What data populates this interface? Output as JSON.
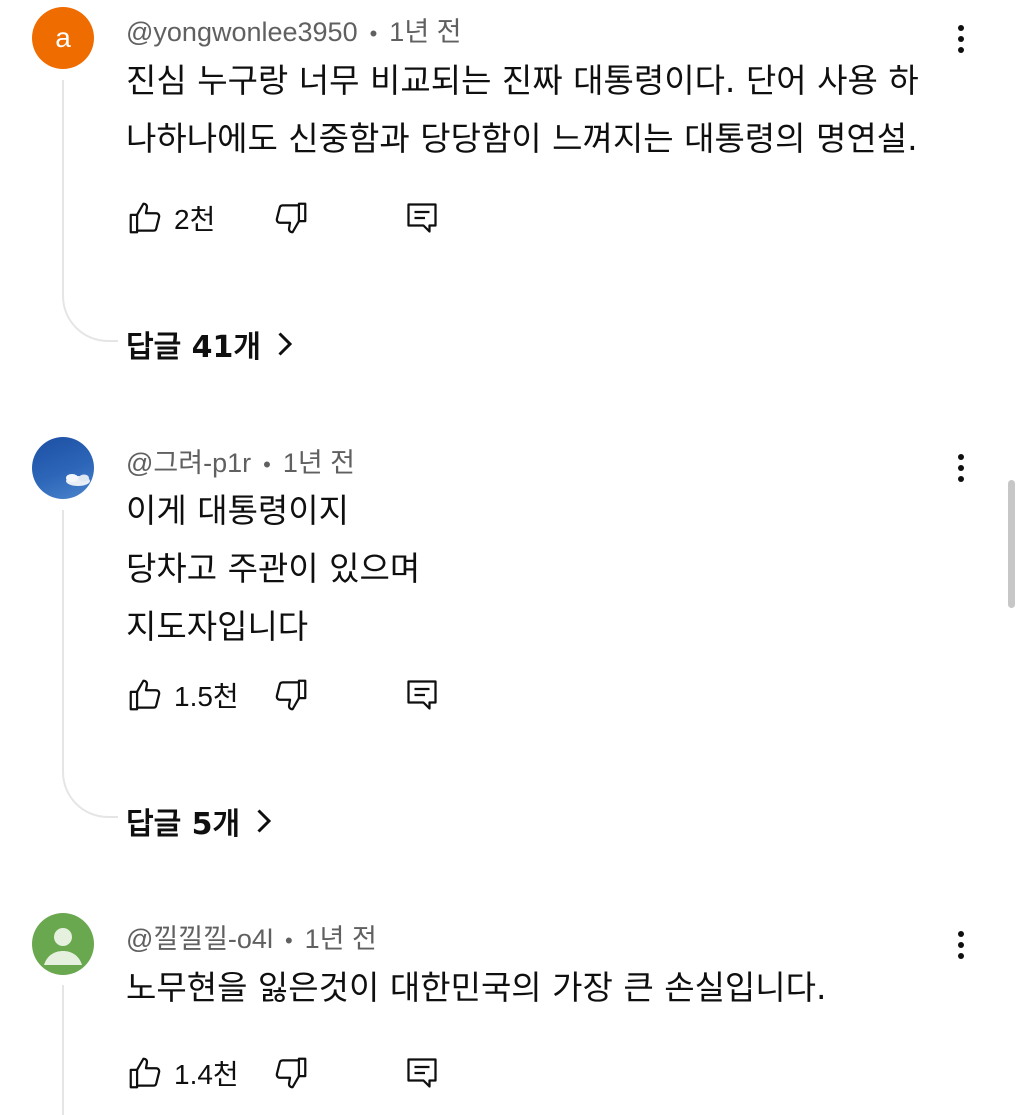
{
  "comments": [
    {
      "handle": "@yongwonlee3950",
      "time": "1년 전",
      "avatar_letter": "a",
      "avatar_color": "#ef6c00",
      "lines": [
        "진심 누구랑 너무 비교되는 진짜 대통령이다. 단어 사용 하",
        "나하나에도 신중함과 당당함이 느껴지는 대통령의 명연설."
      ],
      "likes": "2천",
      "replies": "답글 41개"
    },
    {
      "handle": "@그려-p1r",
      "time": "1년 전",
      "avatar_type": "sky-photo",
      "lines": [
        "이게 대통령이지",
        "당차고 주관이 있으며",
        "지도자입니다"
      ],
      "likes": "1.5천",
      "replies": "답글 5개"
    },
    {
      "handle": "@낄낄낄-o4l",
      "time": "1년 전",
      "avatar_type": "default-person",
      "avatar_color": "#6aa84f",
      "lines": [
        "노무현을 잃은것이 대한민국의 가장 큰 손실입니다."
      ],
      "likes": "1.4천"
    }
  ],
  "icons": {
    "like": "thumb-up-icon",
    "dislike": "thumb-down-icon",
    "reply": "reply-comment-icon",
    "more": "more-vert-icon",
    "replies_chevron": "chevron-right-icon"
  }
}
